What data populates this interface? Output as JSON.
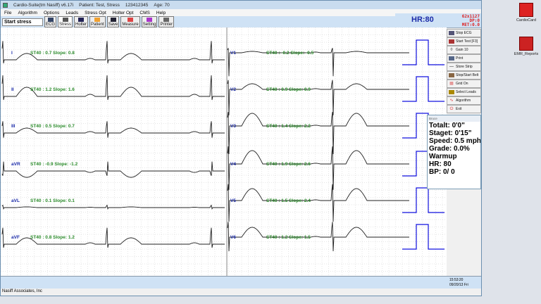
{
  "window": {
    "title": "Cardio-Suite(tm Nasiff) v6.17i",
    "patient": "Patient: Test, Stress",
    "id": "123412345",
    "age": "Age: 70"
  },
  "menu": [
    "File",
    "Algorithm",
    "Options",
    "Leads",
    "Stress Opt",
    "Holter Opt",
    "CMS",
    "Help"
  ],
  "toolbar": {
    "status": "Start stress",
    "buttons": [
      "ECG",
      "Stress",
      "Holter",
      "Patient",
      "Save",
      "Measure",
      "Setting",
      "Printer"
    ]
  },
  "hr": {
    "label": "HR:80",
    "line1": "62x1127",
    "line2": "DP:0",
    "line3": "MET:0.0"
  },
  "side_buttons": [
    "Stop ECG",
    "Start Test [F3]",
    "Gain 10",
    "Print",
    "Store Strip",
    "Stop/Start Belt",
    "Grid On",
    "Select Leads",
    "Algorithm",
    "Exit"
  ],
  "bruce": {
    "title": "Bruce",
    "lines": [
      "Totalt: 0'0\"",
      "Staget: 0'15\"",
      "Speed: 0.5  mph",
      "Grade: 0.0%",
      "Warmup",
      "HR: 80",
      "BP:   0/  0"
    ]
  },
  "leads": [
    {
      "name": "I",
      "st": "ST40 : 0.7 Slope: 0.8"
    },
    {
      "name": "II",
      "st": "ST40 : 1.2 Slope: 1.6"
    },
    {
      "name": "III",
      "st": "ST40 : 0.5 Slope: 0.7"
    },
    {
      "name": "aVR",
      "st": "ST40 : -0.9 Slope: -1.2"
    },
    {
      "name": "aVL",
      "st": "ST40 : 0.1 Slope: 0.1"
    },
    {
      "name": "aVF",
      "st": "ST40 : 0.8 Slope: 1.2"
    },
    {
      "name": "V1",
      "st": "ST40 : -0.2 Slope: -0.5"
    },
    {
      "name": "V2",
      "st": "ST40 : 0.9 Slope: 0.9"
    },
    {
      "name": "V3",
      "st": "ST40 : 1.4 Slope: 2.2"
    },
    {
      "name": "V4",
      "st": "ST40 : 1.9 Slope: 2.6"
    },
    {
      "name": "V5",
      "st": "ST40 : 1.5 Slope: 2.4"
    },
    {
      "name": "V6",
      "st": "ST40 : 1.2 Slope: 1.5"
    }
  ],
  "status": {
    "time": "15:53:20",
    "date": "09/20/13 Fri",
    "company": "Nasiff Associates, Inc"
  },
  "desktop": [
    "CardioCard",
    "EMR_Reports"
  ],
  "colors": {
    "lead_label": "#1a2aa8",
    "st_text": "#2a8a2a",
    "trace": "#222",
    "calib": "#1010e0"
  }
}
